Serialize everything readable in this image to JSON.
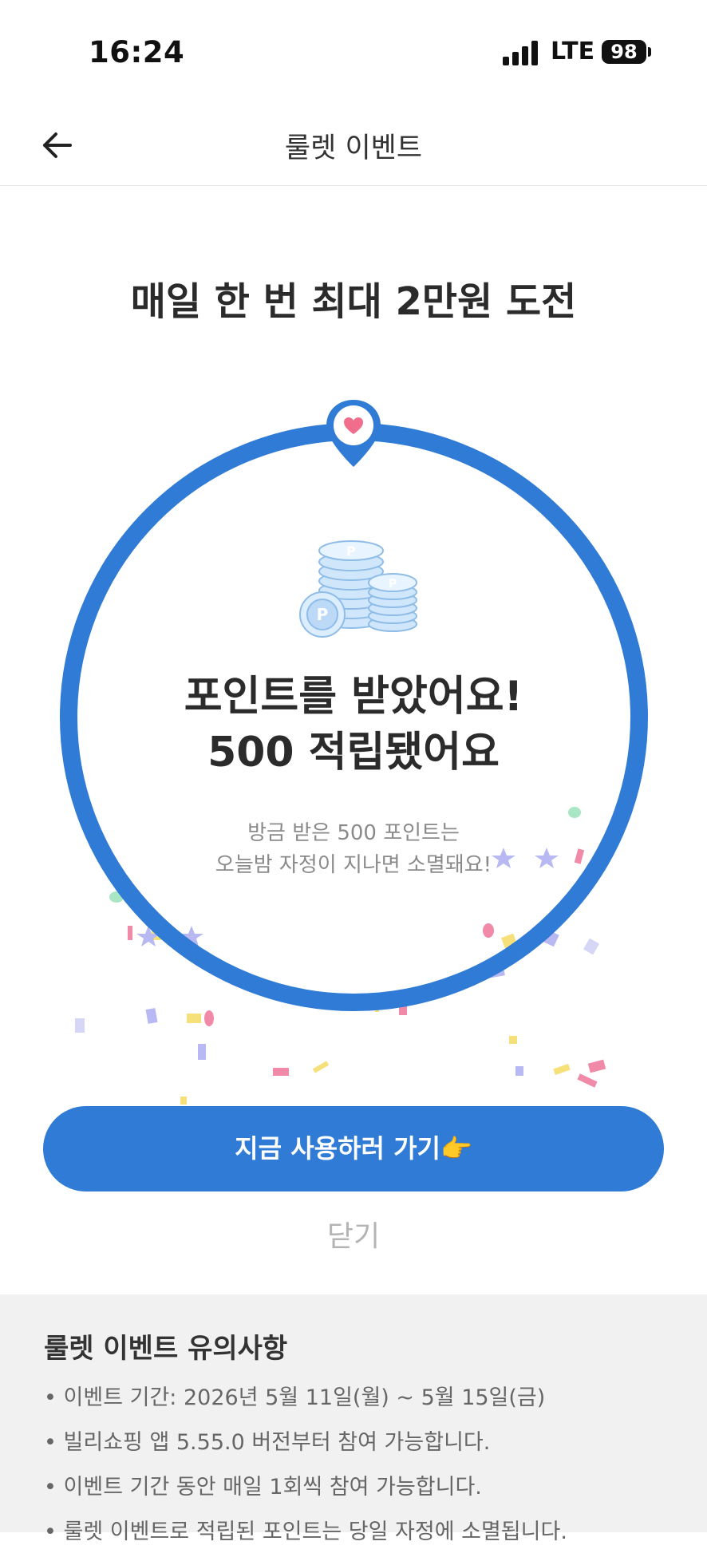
{
  "status_bar": {
    "time": "16:24",
    "network": "LTE",
    "battery": "98"
  },
  "header": {
    "back_icon": "arrow-left-icon",
    "title": "룰렛 이벤트"
  },
  "headline": "매일 한 번 최대 2만원 도전",
  "roulette": {
    "accent_color": "#2f7bd5",
    "pin_icon": "heart-pin-icon",
    "reward_icon": "coin-stack-icon",
    "result_line1": "포인트를 받았어요!",
    "result_line2": "500 적립됐어요",
    "note_line1": "방금 받은 500 포인트는",
    "note_line2": "오늘밤 자정이 지나면 소멸돼요!"
  },
  "actions": {
    "primary_label": "지금 사용하러 가기👉",
    "close_label": "닫기"
  },
  "notice": {
    "title": "룰렛 이벤트 유의사항",
    "items": [
      "이벤트 기간: 2026년 5월 11일(월) ~ 5월 15일(금)",
      "빌리쇼핑 앱 5.55.0 버전부터 참여 가능합니다.",
      "이벤트 기간 동안 매일 1회씩 참여 가능합니다.",
      "룰렛 이벤트로 적립된 포인트는 당일 자정에 소멸됩니다."
    ]
  }
}
